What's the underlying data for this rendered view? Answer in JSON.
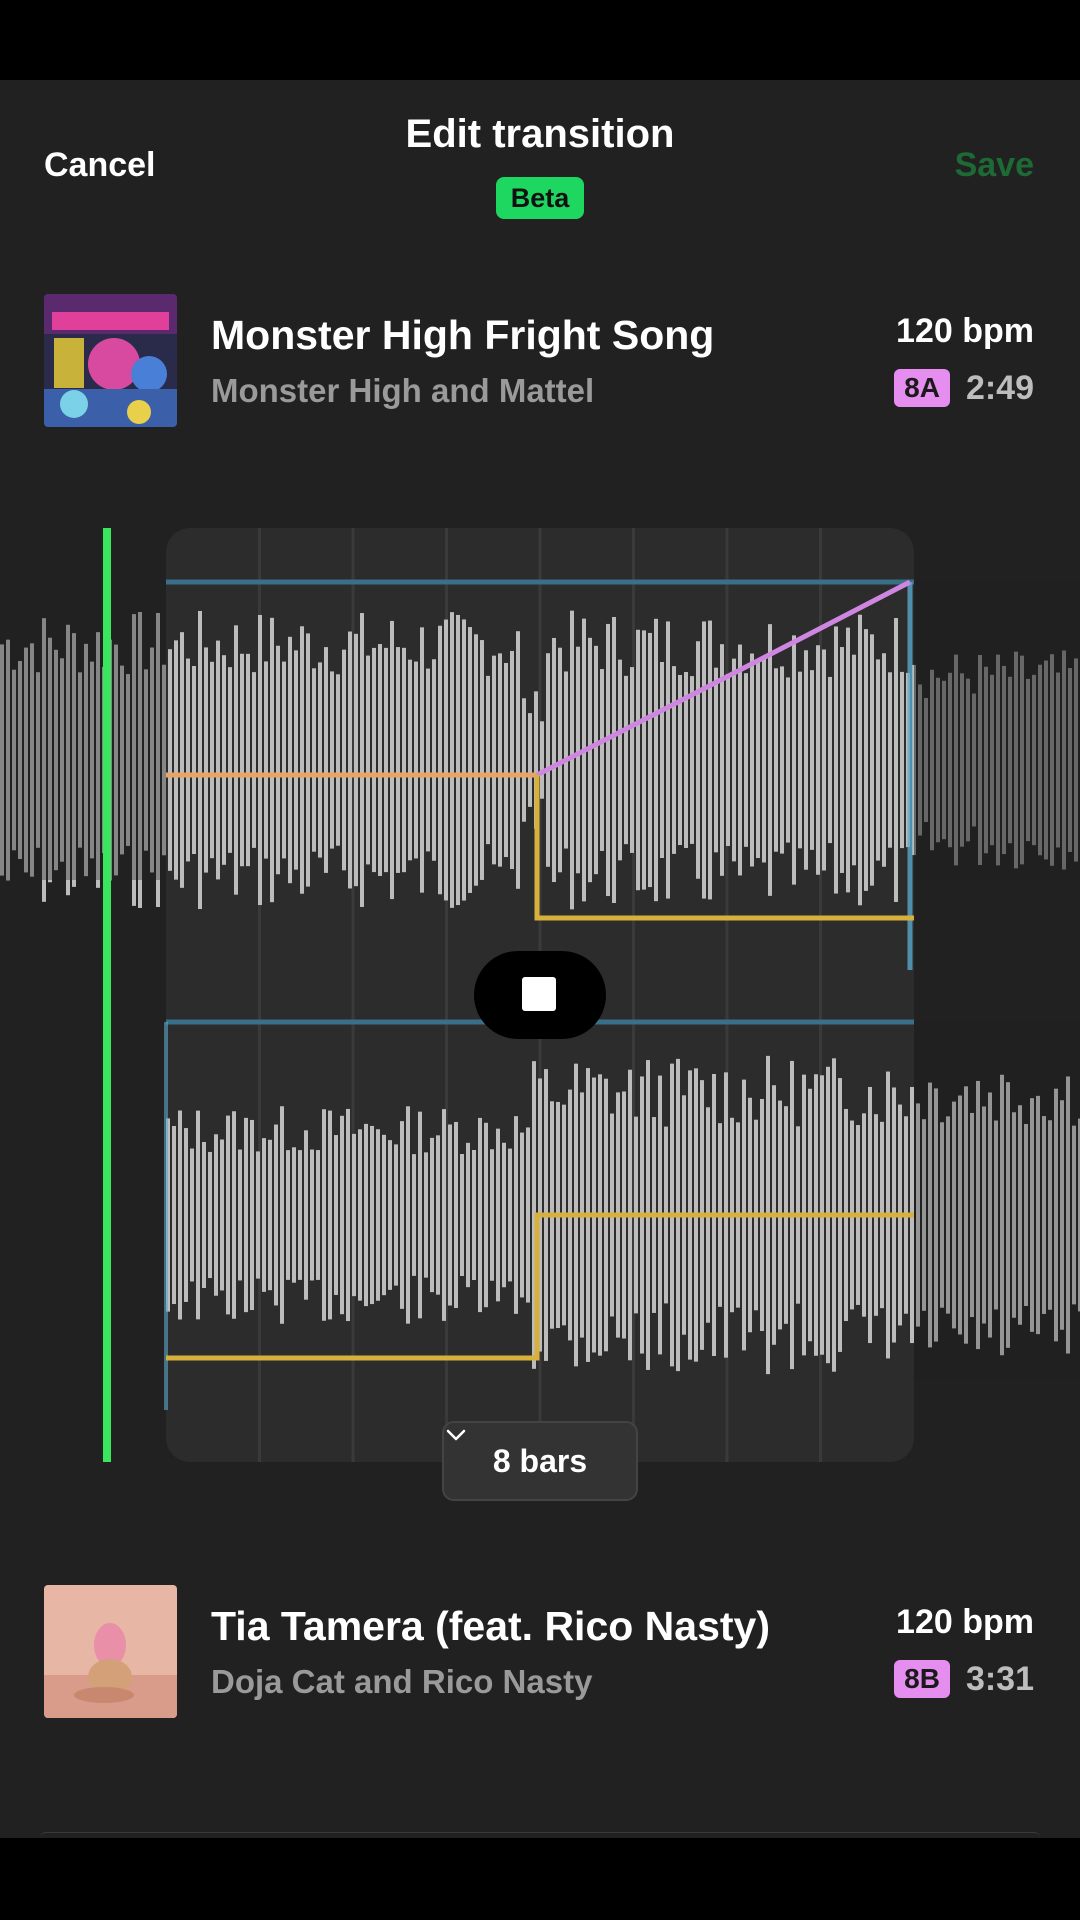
{
  "header": {
    "cancel_label": "Cancel",
    "title": "Edit transition",
    "badge": "Beta",
    "save_label": "Save"
  },
  "track_out": {
    "title": "Monster High Fright Song",
    "artist": "Monster High and Mattel",
    "bpm": "120 bpm",
    "key": "8A",
    "duration": "2:49",
    "art_icon": "album-art-monster-high"
  },
  "track_in": {
    "title": "Tia Tamera (feat. Rico Nasty)",
    "artist": "Doja Cat and Rico Nasty",
    "bpm": "120 bpm",
    "key": "8B",
    "duration": "3:31",
    "art_icon": "album-art-doja-cat"
  },
  "editor": {
    "bars_label": "8 bars",
    "playback_state": "playing",
    "stop_icon": "stop-icon"
  },
  "colors": {
    "accent": "#1ed760",
    "save_disabled": "#1d6a35",
    "key_badge": "#e68df0",
    "playhead": "#39e75f",
    "curve_blue": "#3a6f8a",
    "curve_orange": "#e8a567",
    "curve_yellow": "#d7b13c",
    "curve_pink": "#cf86e0"
  }
}
